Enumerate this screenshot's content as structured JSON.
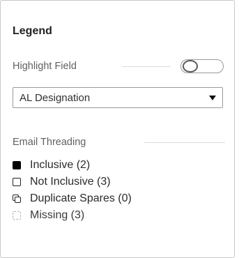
{
  "legend": {
    "title": "Legend",
    "highlight_field": {
      "label": "Highlight Field",
      "toggle_on": false
    },
    "field_select": {
      "selected": "AL Designation"
    },
    "email_threading": {
      "label": "Email Threading",
      "items": [
        {
          "label": "Inclusive (2)",
          "icon": "filled-square-icon"
        },
        {
          "label": "Not Inclusive (3)",
          "icon": "outline-square-icon"
        },
        {
          "label": "Duplicate Spares (0)",
          "icon": "duplicate-squares-icon"
        },
        {
          "label": "Missing (3)",
          "icon": "dashed-square-icon"
        }
      ]
    }
  },
  "colors": {
    "text": "#2a2a2a",
    "muted_text": "#606060",
    "border": "#9a9a9a",
    "missing_icon": "#b0b0b0"
  }
}
